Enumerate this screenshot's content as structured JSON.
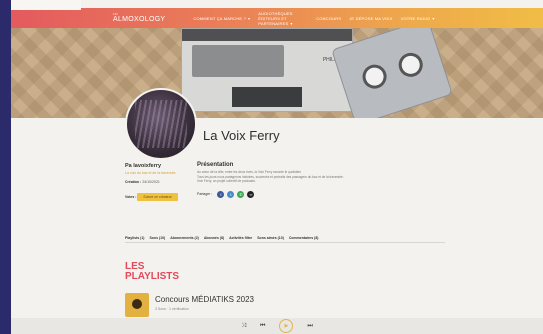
{
  "nav": {
    "logo": "ALMOXOLOGY",
    "logo_sub": "•••",
    "items": [
      "Comment ça marche ?",
      "Audiothèques éditeurs et partenaires",
      "Concours",
      "Je dépose ma voix",
      "Votre radio"
    ]
  },
  "banner": {
    "brand": "PHILIPS"
  },
  "profile": {
    "title": "La Voix Ferry",
    "username": "Pa lavoixferry",
    "subtitle": "La voix du bac et de la traversée",
    "created_label": "Création :",
    "created_value": "24/10/2021",
    "votes_label": "Votes :",
    "follow_label": "Suivre ce créateur",
    "presentation_title": "Présentation",
    "presentation_lines": [
      "Au cœur de la ville, entre les deux rives, la Voix Ferry raconte le quotidien",
      "Tous les jours nous partageons histoires, souvenirs et portraits des passagers du bac et de la traversée.",
      "Voix Ferry, un projet collectif de podcasts."
    ],
    "share_label": "Partager :"
  },
  "tabs": [
    "Playlists (1)",
    "Sons (10)",
    "Abonnements (2)",
    "Abonnés (8)",
    "Activités filtre",
    "Sons aimés (10)",
    "Commentaires (8)"
  ],
  "playlists": {
    "heading_line1": "LES",
    "heading_line2": "PLAYLISTS",
    "items": [
      {
        "title": "Concours MÉDIATIKS 2023",
        "subtitle": "3 Sons · 1 vérification"
      }
    ]
  },
  "icons": {
    "share": [
      "facebook-icon",
      "twitter-icon",
      "whatsapp-icon",
      "link-icon"
    ],
    "player": [
      "shuffle-icon",
      "previous-icon",
      "play-icon",
      "next-icon"
    ]
  },
  "colors": {
    "nav_start": "#e45a5f",
    "nav_end": "#f0bd46",
    "accent": "#e14a5a",
    "follow": "#f0c03f"
  }
}
